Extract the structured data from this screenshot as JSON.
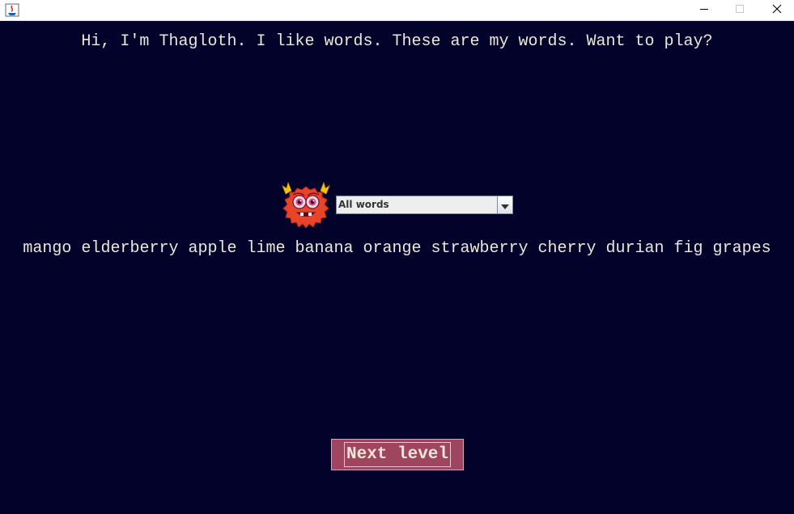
{
  "window": {
    "controls": {
      "minimize": "minimize",
      "maximize": "maximize",
      "close": "close"
    }
  },
  "game": {
    "greeting": "Hi, I'm Thagloth. I like words. These are my words. Want to play?",
    "filter": {
      "selected": "All words"
    },
    "words": [
      "mango",
      "elderberry",
      "apple",
      "lime",
      "banana",
      "orange",
      "strawberry",
      "cherry",
      "durian",
      "fig",
      "grapes"
    ],
    "words_text": "mango elderberry apple lime banana orange strawberry cherry durian fig grapes",
    "next_button_label": "Next level"
  },
  "icons": {
    "app": "java-app-icon",
    "character": "monster-avatar-icon",
    "dropdown": "chevron-down-icon"
  },
  "colors": {
    "background": "#03022b",
    "text": "#ece7d9",
    "button": "#a04560",
    "monster": "#e8442a",
    "horns": "#f2c21a"
  }
}
